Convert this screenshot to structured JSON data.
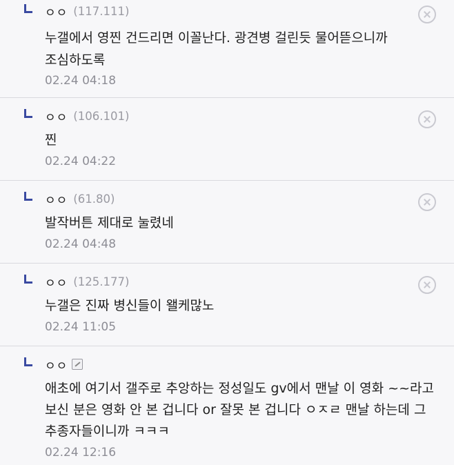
{
  "comments": [
    {
      "nick": "ㅇㅇ",
      "ip": "(117.111)",
      "content": "누갤에서 영찐 건드리면 이꼴난다. 광견병 걸린듯 물어뜯으니까 조심하도록",
      "date": "02.24 04:18",
      "deletable": true
    },
    {
      "nick": "ㅇㅇ",
      "ip": "(106.101)",
      "content": "찐",
      "date": "02.24 04:22",
      "deletable": true
    },
    {
      "nick": "ㅇㅇ",
      "ip": "(61.80)",
      "content": "발작버튼 제대로 눌렸네",
      "date": "02.24 04:48",
      "deletable": true
    },
    {
      "nick": "ㅇㅇ",
      "ip": "(125.177)",
      "content": "누갤은 진짜 병신들이 왤케많노",
      "date": "02.24 11:05",
      "deletable": true
    },
    {
      "nick": "ㅇㅇ",
      "ip": "",
      "content": "애초에 여기서 갤주로 추앙하는 정성일도 gv에서 맨날 이 영화 ~~라고 보신 분은 영화 안 본 겁니다 or 잘못 본 겁니다 ㅇㅈㄹ 맨날 하는데 그 추종자들이니까 ㅋㅋㅋ",
      "date": "02.24 12:16",
      "deletable": false,
      "has_edit_icon": true
    }
  ]
}
